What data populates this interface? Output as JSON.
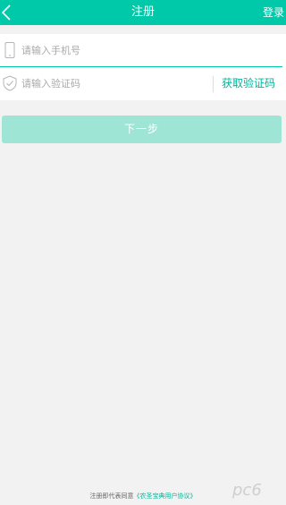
{
  "header": {
    "title": "注册",
    "login_label": "登录"
  },
  "form": {
    "phone": {
      "placeholder": "请输入手机号"
    },
    "code": {
      "placeholder": "请输入验证码",
      "get_code_label": "获取验证码"
    }
  },
  "next_button": {
    "label": "下一步"
  },
  "agreement": {
    "prefix": "注册即代表同意",
    "link": "《农圣宝典用户协议》"
  },
  "watermark": {
    "text": "pc6"
  },
  "colors": {
    "accent": "#00c9a9",
    "link": "#00b49a",
    "button_disabled": "#9ee5d6",
    "background": "#f2f2f2"
  },
  "icons": {
    "back": "chevron-left-icon",
    "phone": "mobile-phone-icon",
    "code": "verification-shield-icon"
  }
}
